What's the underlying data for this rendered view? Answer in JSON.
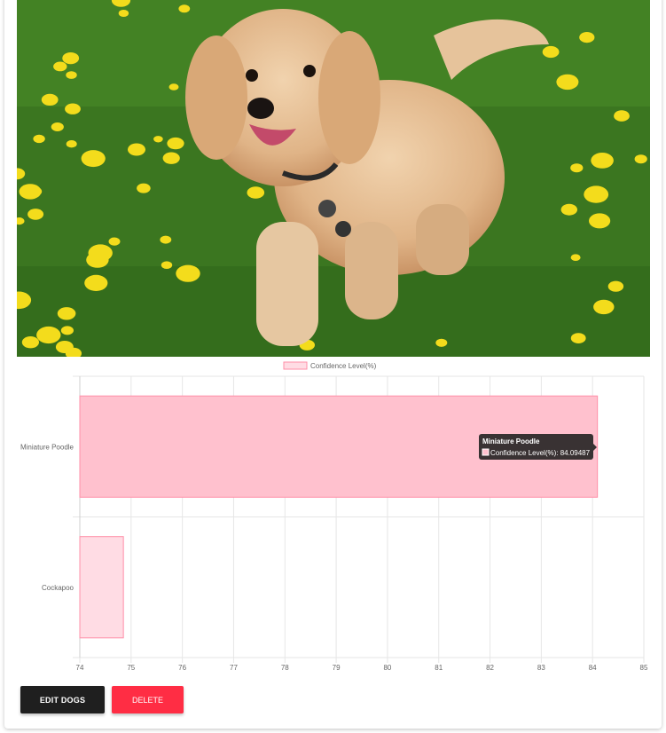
{
  "photo": {
    "subject": "dog-photo",
    "alt": "Dog running on grass with dandelions"
  },
  "chart_data": {
    "type": "bar",
    "orientation": "horizontal",
    "categories": [
      "Miniature Poodle",
      "Cockapoo"
    ],
    "series": [
      {
        "name": "Confidence Level(%)",
        "values": [
          84.09487,
          74.85
        ]
      }
    ],
    "xlim": [
      74,
      85
    ],
    "xticks": [
      "74",
      "75",
      "76",
      "77",
      "78",
      "79",
      "80",
      "81",
      "82",
      "83",
      "84",
      "85"
    ],
    "grid": true,
    "legend_position": "top",
    "colors": {
      "bar_fill": "#ffc1ce",
      "bar_fill_light": "#ffdce4",
      "bar_stroke": "#ff8fa8"
    },
    "tooltip": {
      "title": "Miniature Poodle",
      "label": "Confidence Level(%): 84.09487"
    }
  },
  "actions": {
    "edit_label": "EDIT DOGS",
    "delete_label": "DELETE"
  },
  "colors": {
    "edit_button": "#1f1f1f",
    "delete_button": "#ff2d44"
  }
}
